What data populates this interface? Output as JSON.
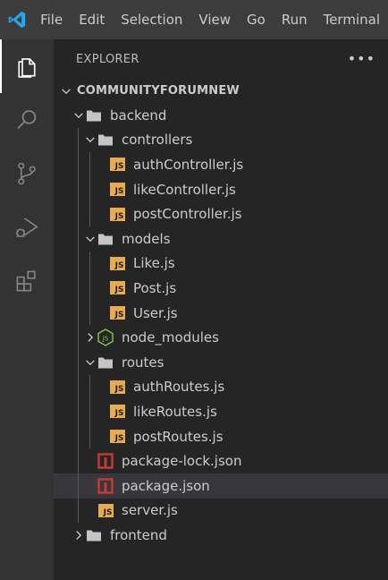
{
  "menu": [
    "File",
    "Edit",
    "Selection",
    "View",
    "Go",
    "Run",
    "Terminal"
  ],
  "activity_bar": {
    "items": [
      {
        "name": "explorer",
        "icon": "files-icon",
        "active": true
      },
      {
        "name": "search",
        "icon": "search-icon",
        "active": false
      },
      {
        "name": "source-control",
        "icon": "source-control-icon",
        "active": false
      },
      {
        "name": "run-debug",
        "icon": "run-debug-icon",
        "active": false
      },
      {
        "name": "extensions",
        "icon": "extensions-icon",
        "active": false
      }
    ]
  },
  "explorer": {
    "title": "EXPLORER",
    "more_icon": "ellipsis-icon",
    "root": "COMMUNITYFORUMNEW",
    "tree": [
      {
        "label": "backend",
        "type": "folder",
        "depth": 0,
        "expanded": true
      },
      {
        "label": "controllers",
        "type": "folder",
        "depth": 1,
        "expanded": true
      },
      {
        "label": "authController.js",
        "type": "js",
        "depth": 2
      },
      {
        "label": "likeController.js",
        "type": "js",
        "depth": 2
      },
      {
        "label": "postController.js",
        "type": "js",
        "depth": 2
      },
      {
        "label": "models",
        "type": "folder",
        "depth": 1,
        "expanded": true
      },
      {
        "label": "Like.js",
        "type": "js",
        "depth": 2
      },
      {
        "label": "Post.js",
        "type": "js",
        "depth": 2
      },
      {
        "label": "User.js",
        "type": "js",
        "depth": 2
      },
      {
        "label": "node_modules",
        "type": "node",
        "depth": 1,
        "expanded": false
      },
      {
        "label": "routes",
        "type": "folder",
        "depth": 1,
        "expanded": true
      },
      {
        "label": "authRoutes.js",
        "type": "js",
        "depth": 2
      },
      {
        "label": "likeRoutes.js",
        "type": "js",
        "depth": 2
      },
      {
        "label": "postRoutes.js",
        "type": "js",
        "depth": 2
      },
      {
        "label": "package-lock.json",
        "type": "npm",
        "depth": 1
      },
      {
        "label": "package.json",
        "type": "npm",
        "depth": 1,
        "selected": true
      },
      {
        "label": "server.js",
        "type": "js",
        "depth": 1
      },
      {
        "label": "frontend",
        "type": "folder",
        "depth": 0,
        "expanded": false
      }
    ]
  },
  "colors": {
    "js": "#e8ab53",
    "npm": "#cb3837",
    "node": "#8cc84b",
    "accent": "#0078d4",
    "selected_row": "#37373d"
  }
}
